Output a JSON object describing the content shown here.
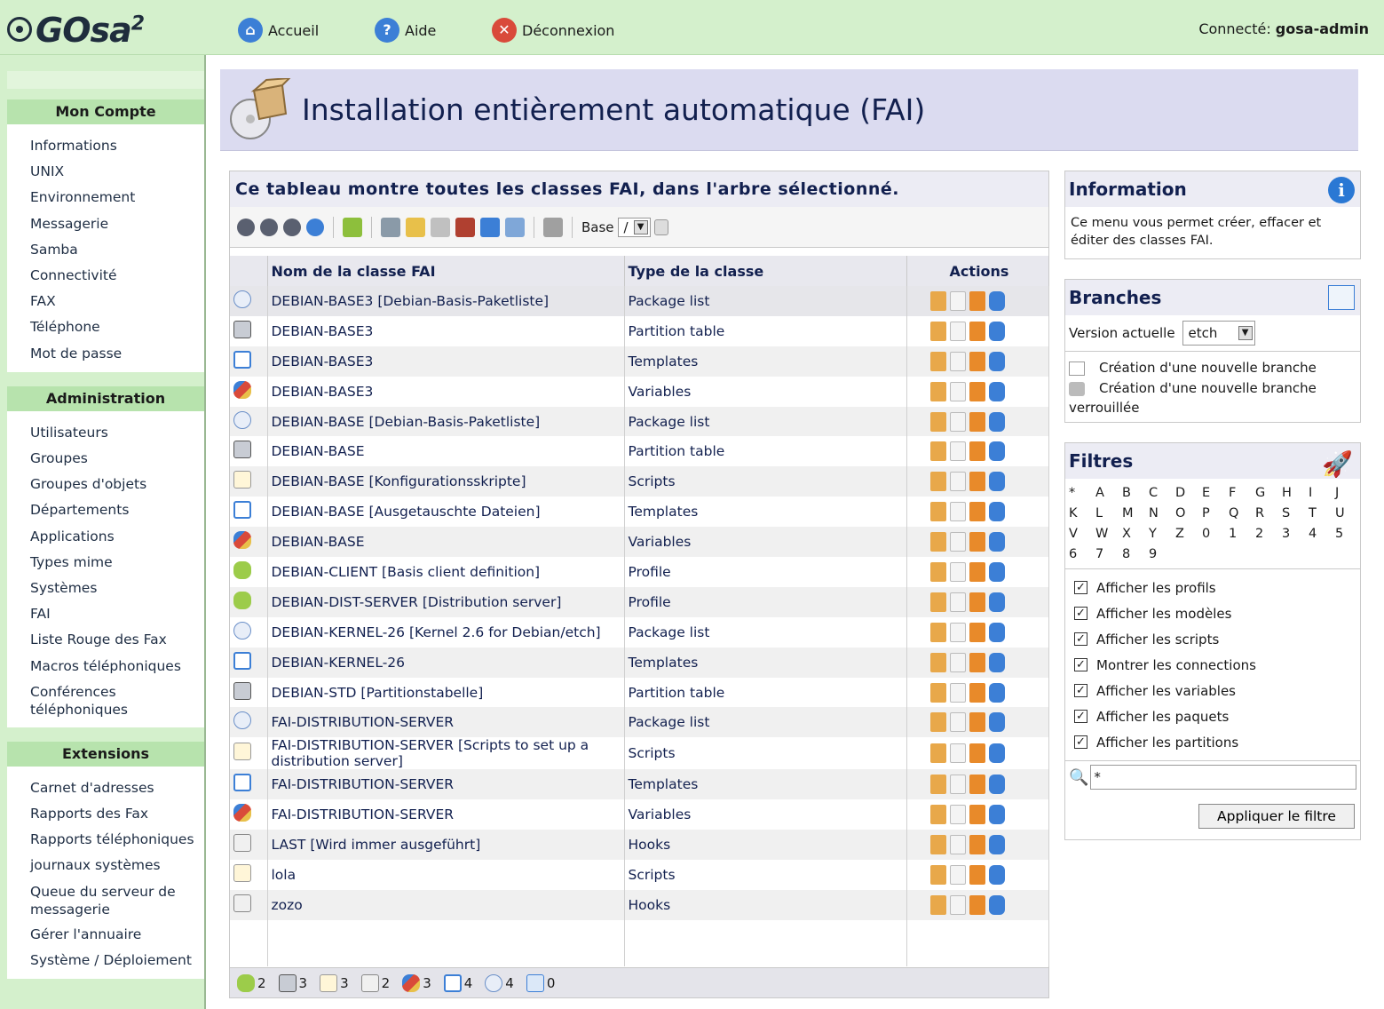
{
  "app": {
    "logo": "GOsa",
    "logo_sup": "2"
  },
  "topnav": {
    "home": "Accueil",
    "help": "Aide",
    "logout": "Déconnexion",
    "connected_label": "Connecté:",
    "user": "gosa-admin"
  },
  "sidebar": {
    "account_title": "Mon Compte",
    "account_items": [
      "Informations",
      "UNIX",
      "Environnement",
      "Messagerie",
      "Samba",
      "Connectivité",
      "FAX",
      "Téléphone",
      "Mot de passe"
    ],
    "admin_title": "Administration",
    "admin_items": [
      "Utilisateurs",
      "Groupes",
      "Groupes d'objets",
      "Départements",
      "Applications",
      "Types mime",
      "Systèmes",
      "FAI",
      "Liste Rouge des Fax",
      "Macros téléphoniques",
      "Conférences téléphoniques"
    ],
    "ext_title": "Extensions",
    "ext_items": [
      "Carnet d'adresses",
      "Rapports des Fax",
      "Rapports téléphoniques",
      "journaux systèmes",
      "Queue du serveur de messagerie",
      "Gérer l'annuaire",
      "Système / Déploiement"
    ]
  },
  "page": {
    "title": "Installation entièrement automatique (FAI)"
  },
  "main": {
    "title": "Ce tableau montre toutes les classes FAI, dans l'arbre sélectionné.",
    "base_label": "Base",
    "base_value": "/",
    "columns": [
      "Nom de la classe FAI",
      "Type de la classe",
      "Actions"
    ],
    "rows": [
      {
        "icon": "package-list",
        "name": "DEBIAN-BASE3 [Debian-Basis-Paketliste]",
        "type": "Package list"
      },
      {
        "icon": "partition-table",
        "name": "DEBIAN-BASE3",
        "type": "Partition table"
      },
      {
        "icon": "template",
        "name": "DEBIAN-BASE3",
        "type": "Templates"
      },
      {
        "icon": "variable",
        "name": "DEBIAN-BASE3",
        "type": "Variables"
      },
      {
        "icon": "package-list",
        "name": "DEBIAN-BASE [Debian-Basis-Paketliste]",
        "type": "Package list"
      },
      {
        "icon": "partition-table",
        "name": "DEBIAN-BASE",
        "type": "Partition table"
      },
      {
        "icon": "script",
        "name": "DEBIAN-BASE [Konfigurationsskripte]",
        "type": "Scripts"
      },
      {
        "icon": "template",
        "name": "DEBIAN-BASE [Ausgetauschte Dateien]",
        "type": "Templates"
      },
      {
        "icon": "variable",
        "name": "DEBIAN-BASE",
        "type": "Variables"
      },
      {
        "icon": "profile",
        "name": "DEBIAN-CLIENT [Basis client definition]",
        "type": "Profile"
      },
      {
        "icon": "profile",
        "name": "DEBIAN-DIST-SERVER [Distribution server]",
        "type": "Profile"
      },
      {
        "icon": "package-list",
        "name": "DEBIAN-KERNEL-26 [Kernel 2.6 for Debian/etch]",
        "type": "Package list"
      },
      {
        "icon": "template",
        "name": "DEBIAN-KERNEL-26",
        "type": "Templates"
      },
      {
        "icon": "partition-table",
        "name": "DEBIAN-STD [Partitionstabelle]",
        "type": "Partition table"
      },
      {
        "icon": "package-list",
        "name": "FAI-DISTRIBUTION-SERVER",
        "type": "Package list"
      },
      {
        "icon": "script",
        "name": "FAI-DISTRIBUTION-SERVER [Scripts to set up a distribution server]",
        "type": "Scripts"
      },
      {
        "icon": "template",
        "name": "FAI-DISTRIBUTION-SERVER",
        "type": "Templates"
      },
      {
        "icon": "variable",
        "name": "FAI-DISTRIBUTION-SERVER",
        "type": "Variables"
      },
      {
        "icon": "hook",
        "name": "LAST [Wird immer ausgeführt]",
        "type": "Hooks"
      },
      {
        "icon": "script",
        "name": "lola",
        "type": "Scripts"
      },
      {
        "icon": "hook",
        "name": "zozo",
        "type": "Hooks"
      }
    ],
    "footer_counts": [
      {
        "icon": "profile",
        "count": "2"
      },
      {
        "icon": "partition-table",
        "count": "3"
      },
      {
        "icon": "script",
        "count": "3"
      },
      {
        "icon": "hook",
        "count": "2"
      },
      {
        "icon": "variable",
        "count": "3"
      },
      {
        "icon": "template",
        "count": "4"
      },
      {
        "icon": "package-list",
        "count": "4"
      },
      {
        "icon": "folder",
        "count": "0"
      }
    ]
  },
  "info_panel": {
    "title": "Information",
    "text": "Ce menu vous permet créer, effacer et éditer des classes FAI."
  },
  "branches_panel": {
    "title": "Branches",
    "version_label": "Version actuelle",
    "version_value": "etch",
    "new_branch": "Création d'une nouvelle branche",
    "new_locked_branch": "Création d'une nouvelle branche verrouillée"
  },
  "filters_panel": {
    "title": "Filtres",
    "letters": [
      "*",
      "A",
      "B",
      "C",
      "D",
      "E",
      "F",
      "G",
      "H",
      "I",
      "J",
      "K",
      "L",
      "M",
      "N",
      "O",
      "P",
      "Q",
      "R",
      "S",
      "T",
      "U",
      "V",
      "W",
      "X",
      "Y",
      "Z",
      "0",
      "1",
      "2",
      "3",
      "4",
      "5",
      "6",
      "7",
      "8",
      "9"
    ],
    "checkboxes": [
      "Afficher les profils",
      "Afficher les modèles",
      "Afficher les scripts",
      "Montrer les connections",
      "Afficher les variables",
      "Afficher les paquets",
      "Afficher les partitions"
    ],
    "search_value": "*",
    "apply_label": "Appliquer le filtre"
  },
  "colors": {
    "green_bg": "#d4f0cc",
    "header_bg": "#dbdbf0",
    "text_dark": "#12204f"
  }
}
